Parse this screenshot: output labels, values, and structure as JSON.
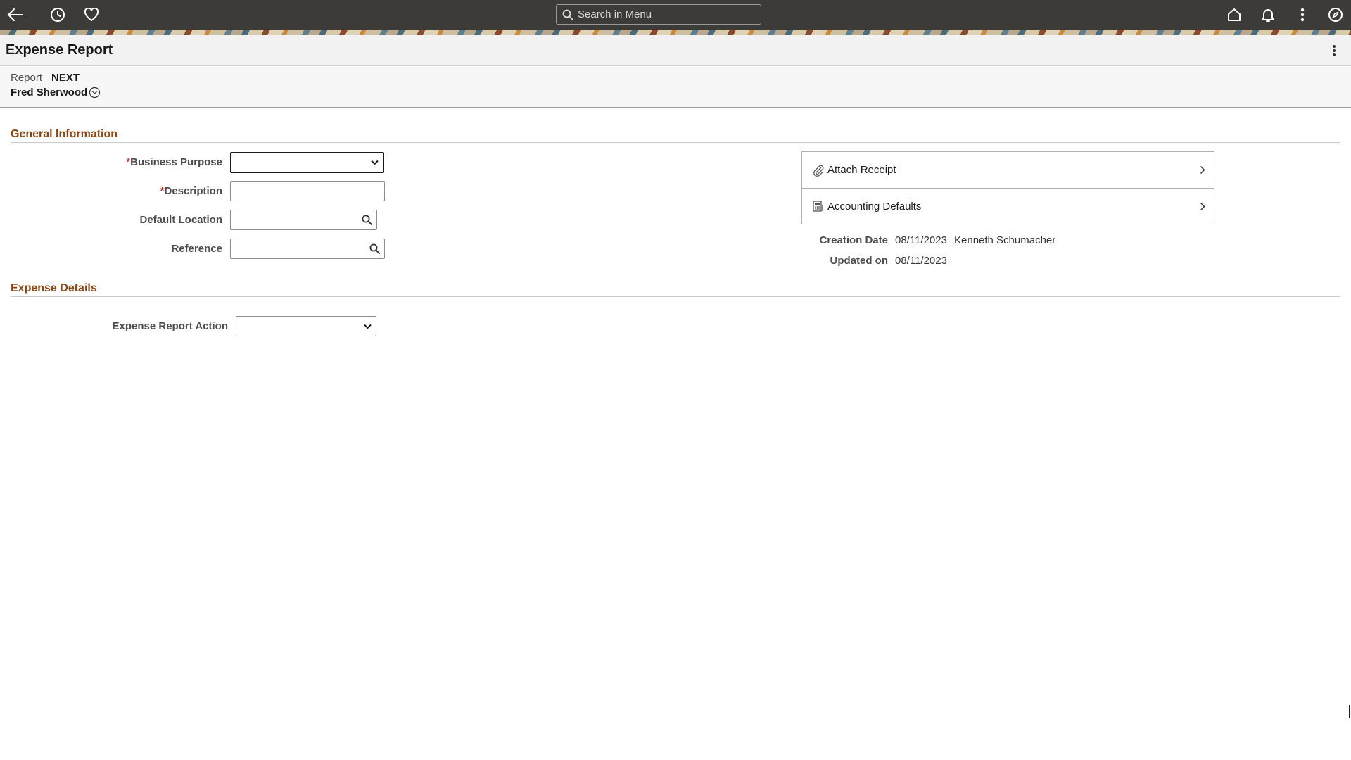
{
  "nav": {
    "search_placeholder": "Search in Menu"
  },
  "page": {
    "title": "Expense Report"
  },
  "context": {
    "report_label": "Report",
    "report_value": "NEXT",
    "user_name": "Fred Sherwood"
  },
  "general_info": {
    "section_title": "General Information",
    "business_purpose": {
      "label": "Business Purpose",
      "required_mark": "*",
      "value": ""
    },
    "description": {
      "label": "Description",
      "required_mark": "*",
      "value": ""
    },
    "default_location": {
      "label": "Default Location",
      "value": ""
    },
    "reference": {
      "label": "Reference",
      "value": ""
    }
  },
  "related_links": {
    "attach_receipt": "Attach Receipt",
    "accounting_defaults": "Accounting Defaults"
  },
  "meta": {
    "creation_date_label": "Creation Date",
    "creation_date_value": "08/11/2023",
    "created_by": "Kenneth Schumacher",
    "updated_on_label": "Updated on",
    "updated_on_value": "08/11/2023"
  },
  "expense_details": {
    "section_title": "Expense Details",
    "action_label": "Expense Report Action",
    "action_value": ""
  },
  "colors": {
    "topbar": "#3c3b38",
    "section_header": "#8b4513"
  }
}
